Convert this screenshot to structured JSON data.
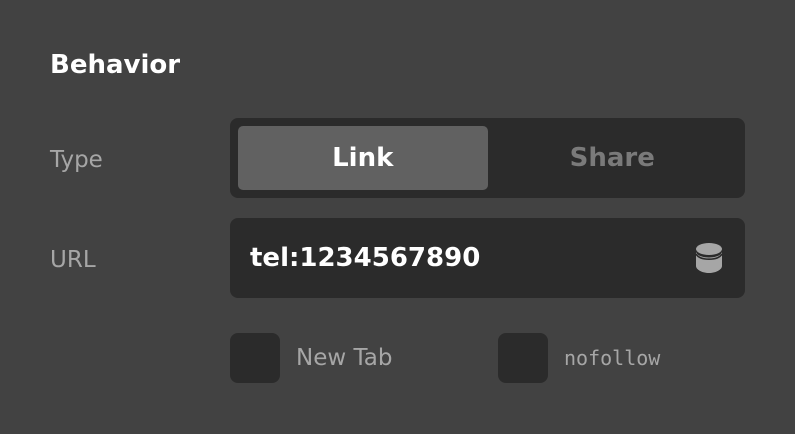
{
  "section": {
    "title": "Behavior"
  },
  "type_field": {
    "label": "Type",
    "options": [
      {
        "label": "Link",
        "selected": true
      },
      {
        "label": "Share",
        "selected": false
      }
    ]
  },
  "url_field": {
    "label": "URL",
    "value": "tel:1234567890",
    "icon": "database-icon"
  },
  "checkboxes": [
    {
      "label": "New Tab",
      "checked": false
    },
    {
      "label": "nofollow",
      "checked": false
    }
  ],
  "colors": {
    "background": "#424242",
    "field_background": "#2b2b2b",
    "active_segment": "#616161",
    "label_text": "#a6a6a6",
    "primary_text": "#ffffff",
    "inactive_text": "#7a7a7a"
  }
}
